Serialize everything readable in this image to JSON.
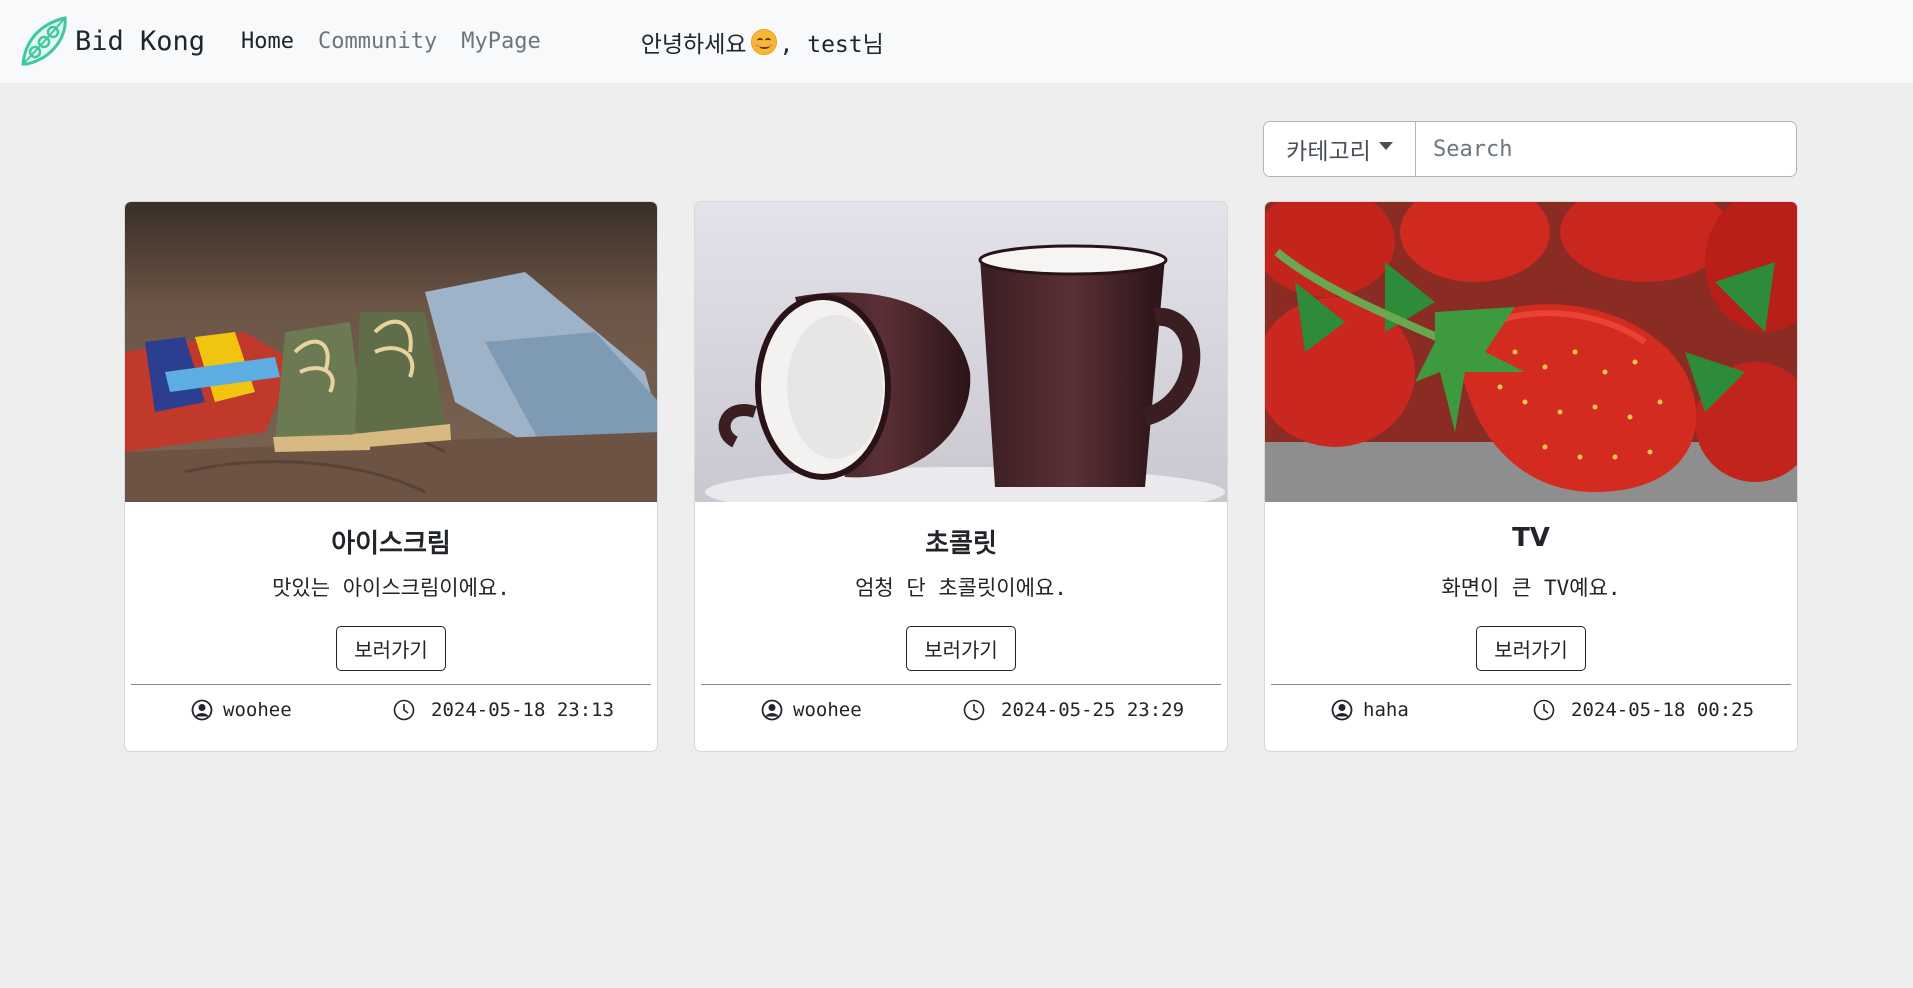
{
  "nav": {
    "brand": "Bid Kong",
    "links": [
      "Home",
      "Community",
      "MyPage"
    ],
    "greeting_prefix": "안녕하세요",
    "greeting_suffix": ", test님"
  },
  "search": {
    "category_label": "카테고리",
    "placeholder": "Search"
  },
  "cards": [
    {
      "title": "아이스크림",
      "description": "맛있는 아이스크림이에요.",
      "button": "보러가기",
      "user": "woohee",
      "date": "2024-05-18 23:13"
    },
    {
      "title": "초콜릿",
      "description": "엄청 단 초콜릿이에요.",
      "button": "보러가기",
      "user": "woohee",
      "date": "2024-05-25 23:29"
    },
    {
      "title": "TV",
      "description": "화면이 큰 TV예요.",
      "button": "보러가기",
      "user": "haha",
      "date": "2024-05-18 00:25"
    }
  ],
  "colors": {
    "background": "#eeeeee",
    "navbar": "#f8f9fa",
    "logo_green": "#3cc9a0"
  }
}
